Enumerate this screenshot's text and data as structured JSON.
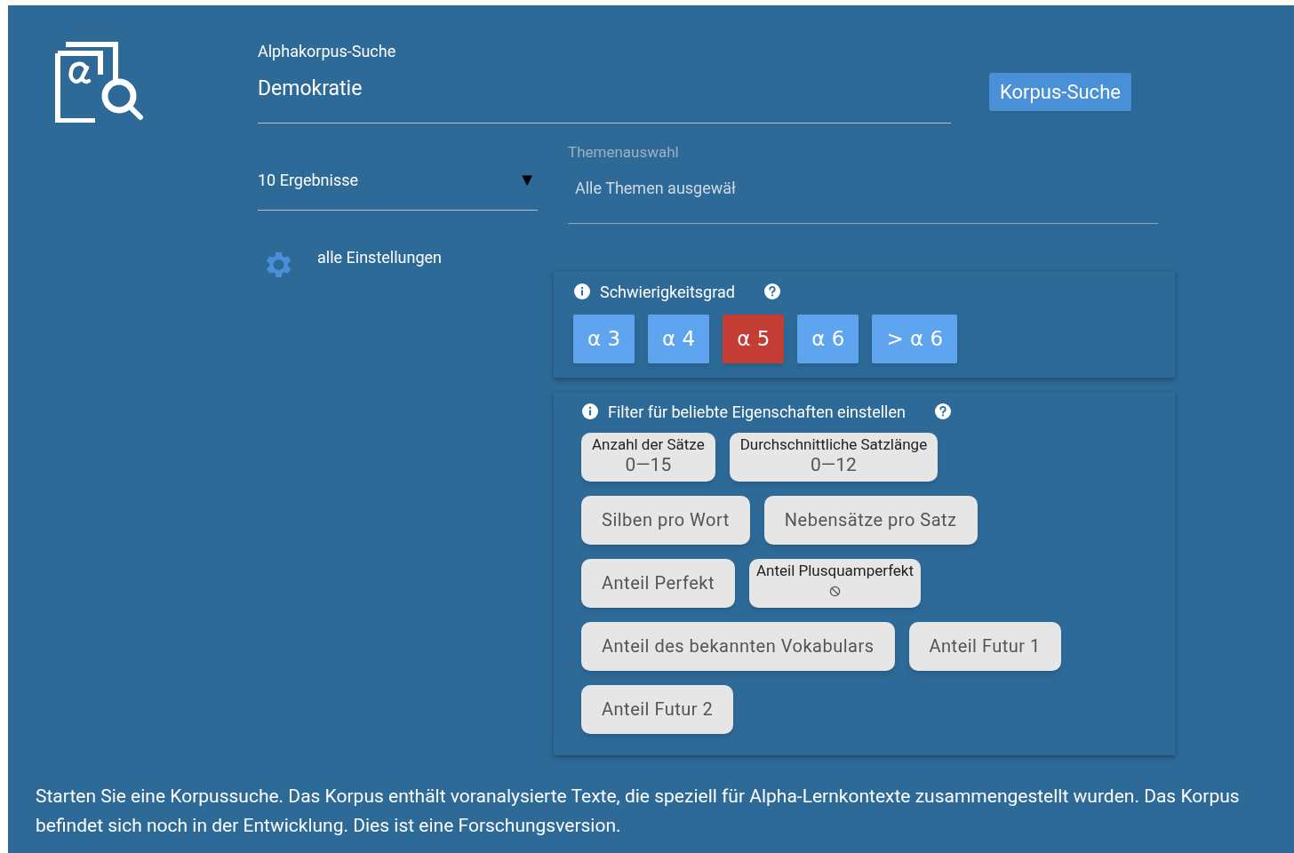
{
  "search": {
    "label": "Alphakorpus-Suche",
    "value": "Demokratie",
    "button": "Korpus-Suche"
  },
  "results_select": {
    "value": "10 Ergebnisse",
    "arrow": "▼"
  },
  "topics": {
    "label": "Themenauswahl",
    "value": "Alle Themen ausgewäł"
  },
  "settings_link": "alle Einstellungen",
  "difficulty": {
    "title": "Schwierigkeitsgrad",
    "levels": [
      {
        "label": "α 3",
        "selected": false
      },
      {
        "label": "α 4",
        "selected": false
      },
      {
        "label": "α 5",
        "selected": true
      },
      {
        "label": "α 6",
        "selected": false
      },
      {
        "label": "> α 6",
        "selected": false
      }
    ]
  },
  "filters": {
    "title": "Filter für beliebte Eigenschaften einstellen",
    "items": [
      {
        "kind": "range",
        "label": "Anzahl der Sätze",
        "value": "0—15"
      },
      {
        "kind": "range",
        "label": "Durchschnittliche Satzlänge",
        "value": "0—12"
      },
      {
        "kind": "plain",
        "label": "Silben pro Wort"
      },
      {
        "kind": "plain",
        "label": "Nebensätze pro Satz"
      },
      {
        "kind": "plain",
        "label": "Anteil Perfekt"
      },
      {
        "kind": "blocked",
        "label": "Anteil Plusquamperfekt"
      },
      {
        "kind": "plain",
        "label": "Anteil des bekannten Vokabulars"
      },
      {
        "kind": "plain",
        "label": "Anteil Futur 1"
      },
      {
        "kind": "plain",
        "label": "Anteil Futur 2"
      }
    ]
  },
  "footer": "Starten Sie eine Korpussuche. Das Korpus enthält voranalysierte Texte, die speziell für Alpha-Lernkontexte zusammengestellt wurden. Das Korpus befindet sich noch in der Entwicklung. Dies ist eine Forschungsversion."
}
